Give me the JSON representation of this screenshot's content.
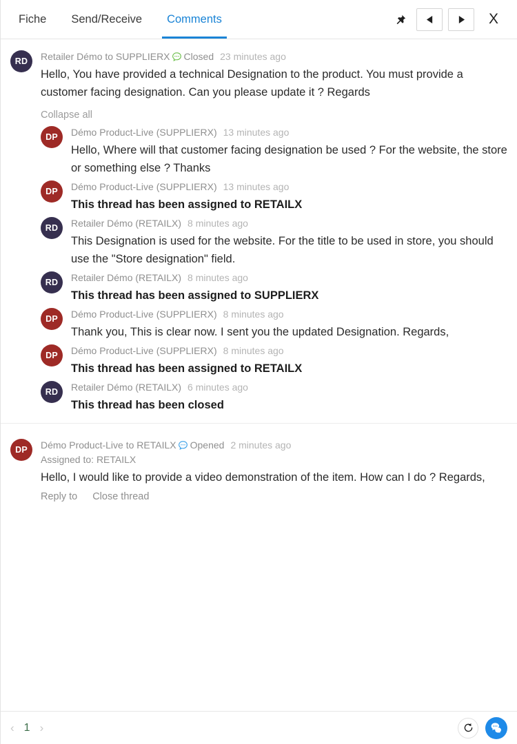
{
  "header": {
    "tabs": [
      {
        "label": "Fiche",
        "active": false
      },
      {
        "label": "Send/Receive",
        "active": false
      },
      {
        "label": "Comments",
        "active": true
      }
    ],
    "actions": {
      "pin": "pin-icon",
      "prev": "previous-record",
      "next": "next-record",
      "close": "X"
    }
  },
  "colors": {
    "accent": "#1a84d6",
    "avatar_retailer": "#362f4f",
    "avatar_supplier": "#9e2a26",
    "status_closed": "#6cbf4a",
    "status_opened": "#3aa0e8",
    "fab": "#1e8ae8",
    "page_number": "#3d6e4a"
  },
  "threads": [
    {
      "status": "Closed",
      "status_icon": "chat-bubble-green-icon",
      "root": {
        "initials": "RD",
        "avatar_type": "rd",
        "author": "Retailer Démo to SUPPLIERX",
        "time": "23 minutes ago",
        "text": "Hello, You have provided a technical Designation to the product. You must provide a customer facing designation. Can you please update it ? Regards"
      },
      "collapse_label": "Collapse all",
      "replies": [
        {
          "initials": "DP",
          "avatar_type": "dp",
          "author": "Démo Product-Live (SUPPLIERX)",
          "time": "13 minutes ago",
          "text": "Hello, Where will that customer facing designation be used ? For the website, the store or something else ? Thanks",
          "system": false
        },
        {
          "initials": "DP",
          "avatar_type": "dp",
          "author": "Démo Product-Live (SUPPLIERX)",
          "time": "13 minutes ago",
          "text": "This thread has been assigned to RETAILX",
          "system": true
        },
        {
          "initials": "RD",
          "avatar_type": "rd",
          "author": "Retailer Démo (RETAILX)",
          "time": "8 minutes ago",
          "text": "This Designation is used for the website. For the title to be used in store, you should use the \"Store designation\" field.",
          "system": false
        },
        {
          "initials": "RD",
          "avatar_type": "rd",
          "author": "Retailer Démo (RETAILX)",
          "time": "8 minutes ago",
          "text": "This thread has been assigned to SUPPLIERX",
          "system": true
        },
        {
          "initials": "DP",
          "avatar_type": "dp",
          "author": "Démo Product-Live (SUPPLIERX)",
          "time": "8 minutes ago",
          "text": "Thank you, This is clear now. I sent you the updated Designation. Regards,",
          "system": false
        },
        {
          "initials": "DP",
          "avatar_type": "dp",
          "author": "Démo Product-Live (SUPPLIERX)",
          "time": "8 minutes ago",
          "text": "This thread has been assigned to RETAILX",
          "system": true
        },
        {
          "initials": "RD",
          "avatar_type": "rd",
          "author": "Retailer Démo (RETAILX)",
          "time": "6 minutes ago",
          "text": "This thread has been closed",
          "system": true
        }
      ]
    },
    {
      "status": "Opened",
      "status_icon": "chat-bubble-blue-icon",
      "root": {
        "initials": "DP",
        "avatar_type": "dp",
        "author": "Démo Product-Live to RETAILX",
        "time": "2 minutes ago",
        "assigned_to": "Assigned to: RETAILX",
        "text": "Hello, I would like to provide a video demonstration of the item. How can I do ? Regards,"
      },
      "actions": {
        "reply": "Reply to",
        "close_thread": "Close thread"
      }
    }
  ],
  "footer": {
    "prev_arrow": "‹",
    "page_number": "1",
    "next_arrow": "›",
    "refresh_icon": "refresh-icon",
    "chat_fab_icon": "chat-bubbles-icon"
  }
}
